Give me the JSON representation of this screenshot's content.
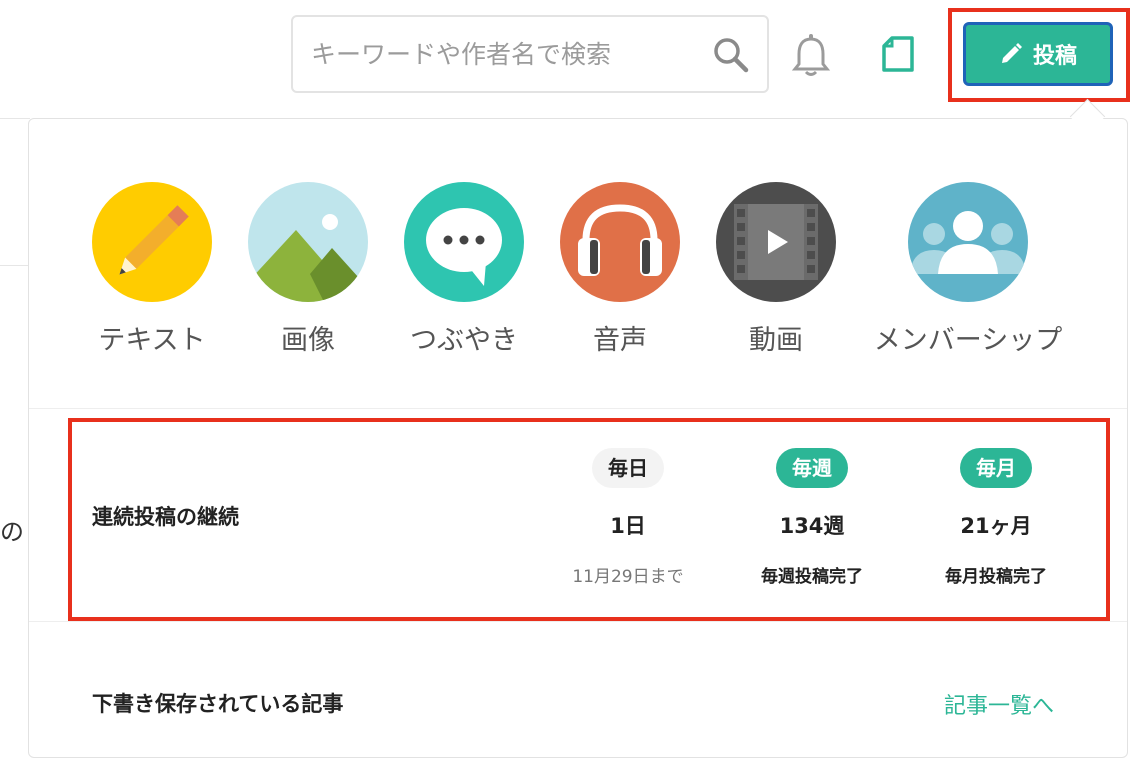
{
  "header": {
    "search": {
      "placeholder": "キーワードや作者名で検索",
      "value": ""
    },
    "post_label": "投稿",
    "accent": "#2cb696",
    "highlight": "#e8301c"
  },
  "left_fragment": "の",
  "post_types": [
    {
      "label": "テキスト",
      "icon": "pencil-icon",
      "color": "#ffcc00"
    },
    {
      "label": "画像",
      "icon": "image-icon",
      "color": "#bfe5ec"
    },
    {
      "label": "つぶやき",
      "icon": "speech-bubble-icon",
      "color": "#2ec5b0"
    },
    {
      "label": "音声",
      "icon": "headphones-icon",
      "color": "#e07048"
    },
    {
      "label": "動画",
      "icon": "film-icon",
      "color": "#4d4d4d"
    },
    {
      "label": "メンバーシップ",
      "icon": "members-icon",
      "color": "#5fb3c9"
    }
  ],
  "streak": {
    "title": "連続投稿の継続",
    "daily": {
      "badge": "毎日",
      "count": "1日",
      "note": "11月29日まで"
    },
    "weekly": {
      "badge": "毎週",
      "count": "134週",
      "note": "毎週投稿完了"
    },
    "monthly": {
      "badge": "毎月",
      "count": "21ヶ月",
      "note": "毎月投稿完了"
    }
  },
  "drafts": {
    "title": "下書き保存されている記事",
    "link": "記事一覧へ"
  }
}
